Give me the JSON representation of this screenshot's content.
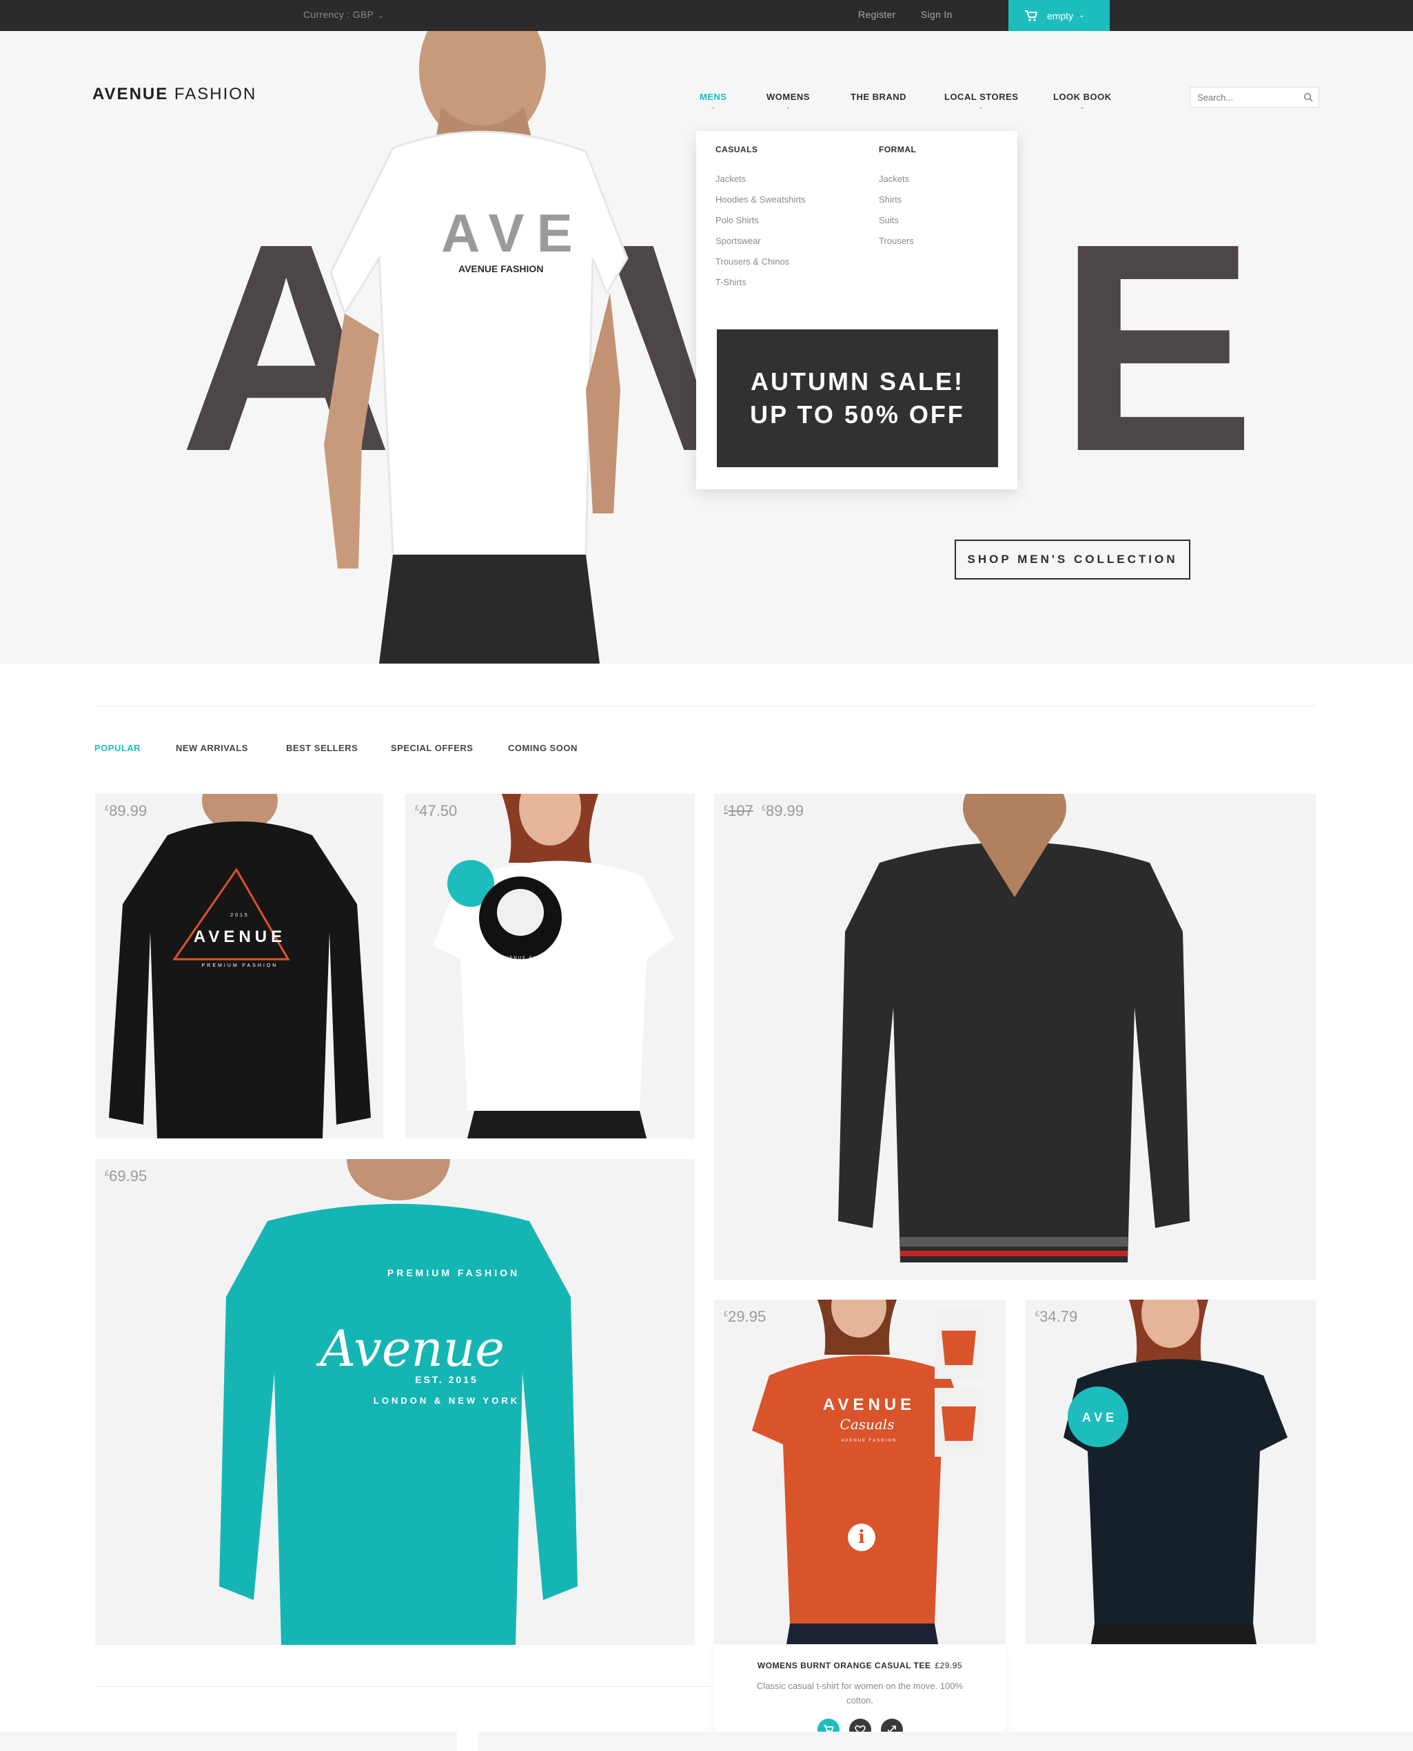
{
  "topbar": {
    "currency_label": "Currency : GBP",
    "register": "Register",
    "sign_in": "Sign In",
    "cart_label": "empty"
  },
  "brand": {
    "logo_bold": "AVENUE",
    "logo_light": " FASHION"
  },
  "nav": [
    {
      "label": "MENS",
      "active": true
    },
    {
      "label": "WOMENS"
    },
    {
      "label": "THE BRAND"
    },
    {
      "label": "LOCAL STORES"
    },
    {
      "label": "LOOK BOOK"
    }
  ],
  "search": {
    "placeholder": "Search..."
  },
  "mega_menu": {
    "casuals": {
      "heading": "CASUALS",
      "items": [
        "Jackets",
        "Hoodies & Sweatshirts",
        "Polo Shirts",
        "Sportswear",
        "Trousers & Chinos",
        "T-Shirts"
      ]
    },
    "formal": {
      "heading": "FORMAL",
      "items": [
        "Jackets",
        "Shirts",
        "Suits",
        "Trousers"
      ]
    },
    "promo": {
      "line1": "AUTUMN SALE!",
      "line2": "UP TO 50% OFF"
    }
  },
  "hero": {
    "letters": [
      "A",
      "V",
      "E"
    ],
    "shirt_print": "AVENUE FASHION",
    "cta": "SHOP MEN'S COLLECTION"
  },
  "tabs": [
    "POPULAR",
    "NEW ARRIVALS",
    "BEST SELLERS",
    "SPECIAL OFFERS",
    "COMING SOON"
  ],
  "products": [
    {
      "currency": "£",
      "price": "89.99",
      "print": "AVENUE",
      "print_sub": "PREMIUM FASHION",
      "print_year": "2015"
    },
    {
      "currency": "£",
      "price": "47.50",
      "print": "AVENUE FASHION"
    },
    {
      "currency": "£",
      "old_price": "107",
      "price": "89.99"
    },
    {
      "currency": "£",
      "price": "69.95",
      "print_top": "PREMIUM FASHION",
      "print": "Avenue",
      "print_est": "EST. 2015",
      "print_bottom": "LONDON & NEW YORK"
    },
    {
      "currency": "£",
      "price": "29.95",
      "print": "AVENUE",
      "print_script": "Casuals",
      "print_sub": "AVENUE FASHION"
    },
    {
      "currency": "£",
      "price": "34.79",
      "print": "A V E"
    }
  ],
  "detail": {
    "name": "WOMENS BURNT ORANGE CASUAL TEE",
    "price": "£29.95",
    "description": "Classic casual t-shirt for women on the move. 100% cotton."
  },
  "colors": {
    "accent": "#1ebdbd",
    "dark": "#2b2b2b",
    "hero_letter": "#4c4647",
    "orange_tee": "#d9532b",
    "teal_tee": "#15b5b4"
  }
}
